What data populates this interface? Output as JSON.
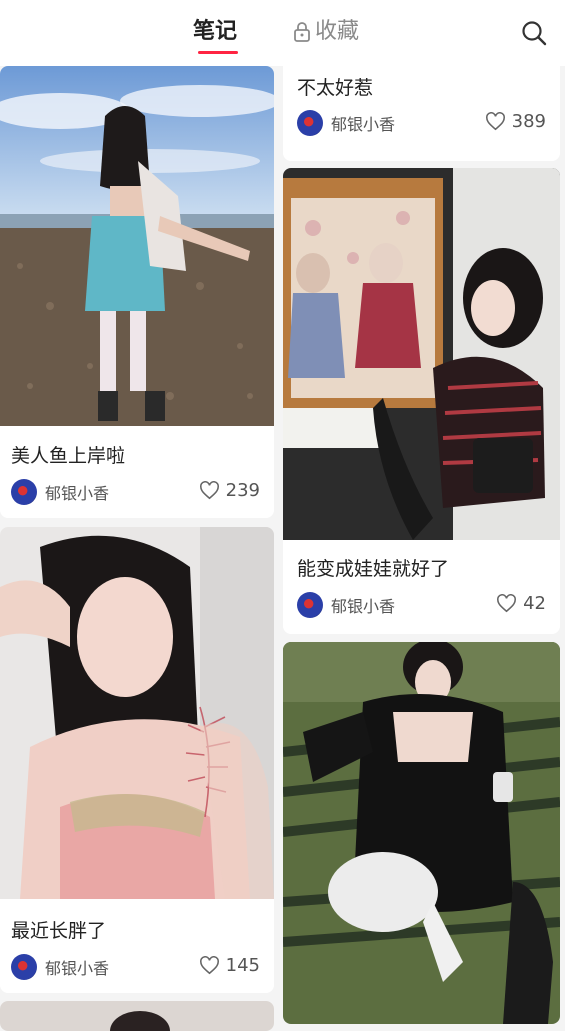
{
  "header": {
    "tab_notes": "笔记",
    "tab_favorites": "收藏",
    "lock_icon": "lock-icon",
    "search_icon": "search-icon"
  },
  "feed": {
    "left": [
      {
        "title": "美人鱼上岸啦",
        "author": "郁银小香",
        "likes": "239"
      },
      {
        "title": "最近长胖了",
        "author": "郁银小香",
        "likes": "145"
      }
    ],
    "right": [
      {
        "title": "不太好惹",
        "author": "郁银小香",
        "likes": "389"
      },
      {
        "title": "能变成娃娃就好了",
        "author": "郁银小香",
        "likes": "42"
      }
    ]
  },
  "colors": {
    "accent": "#ff2442",
    "text": "#222222",
    "muted": "#8a8a8a"
  }
}
